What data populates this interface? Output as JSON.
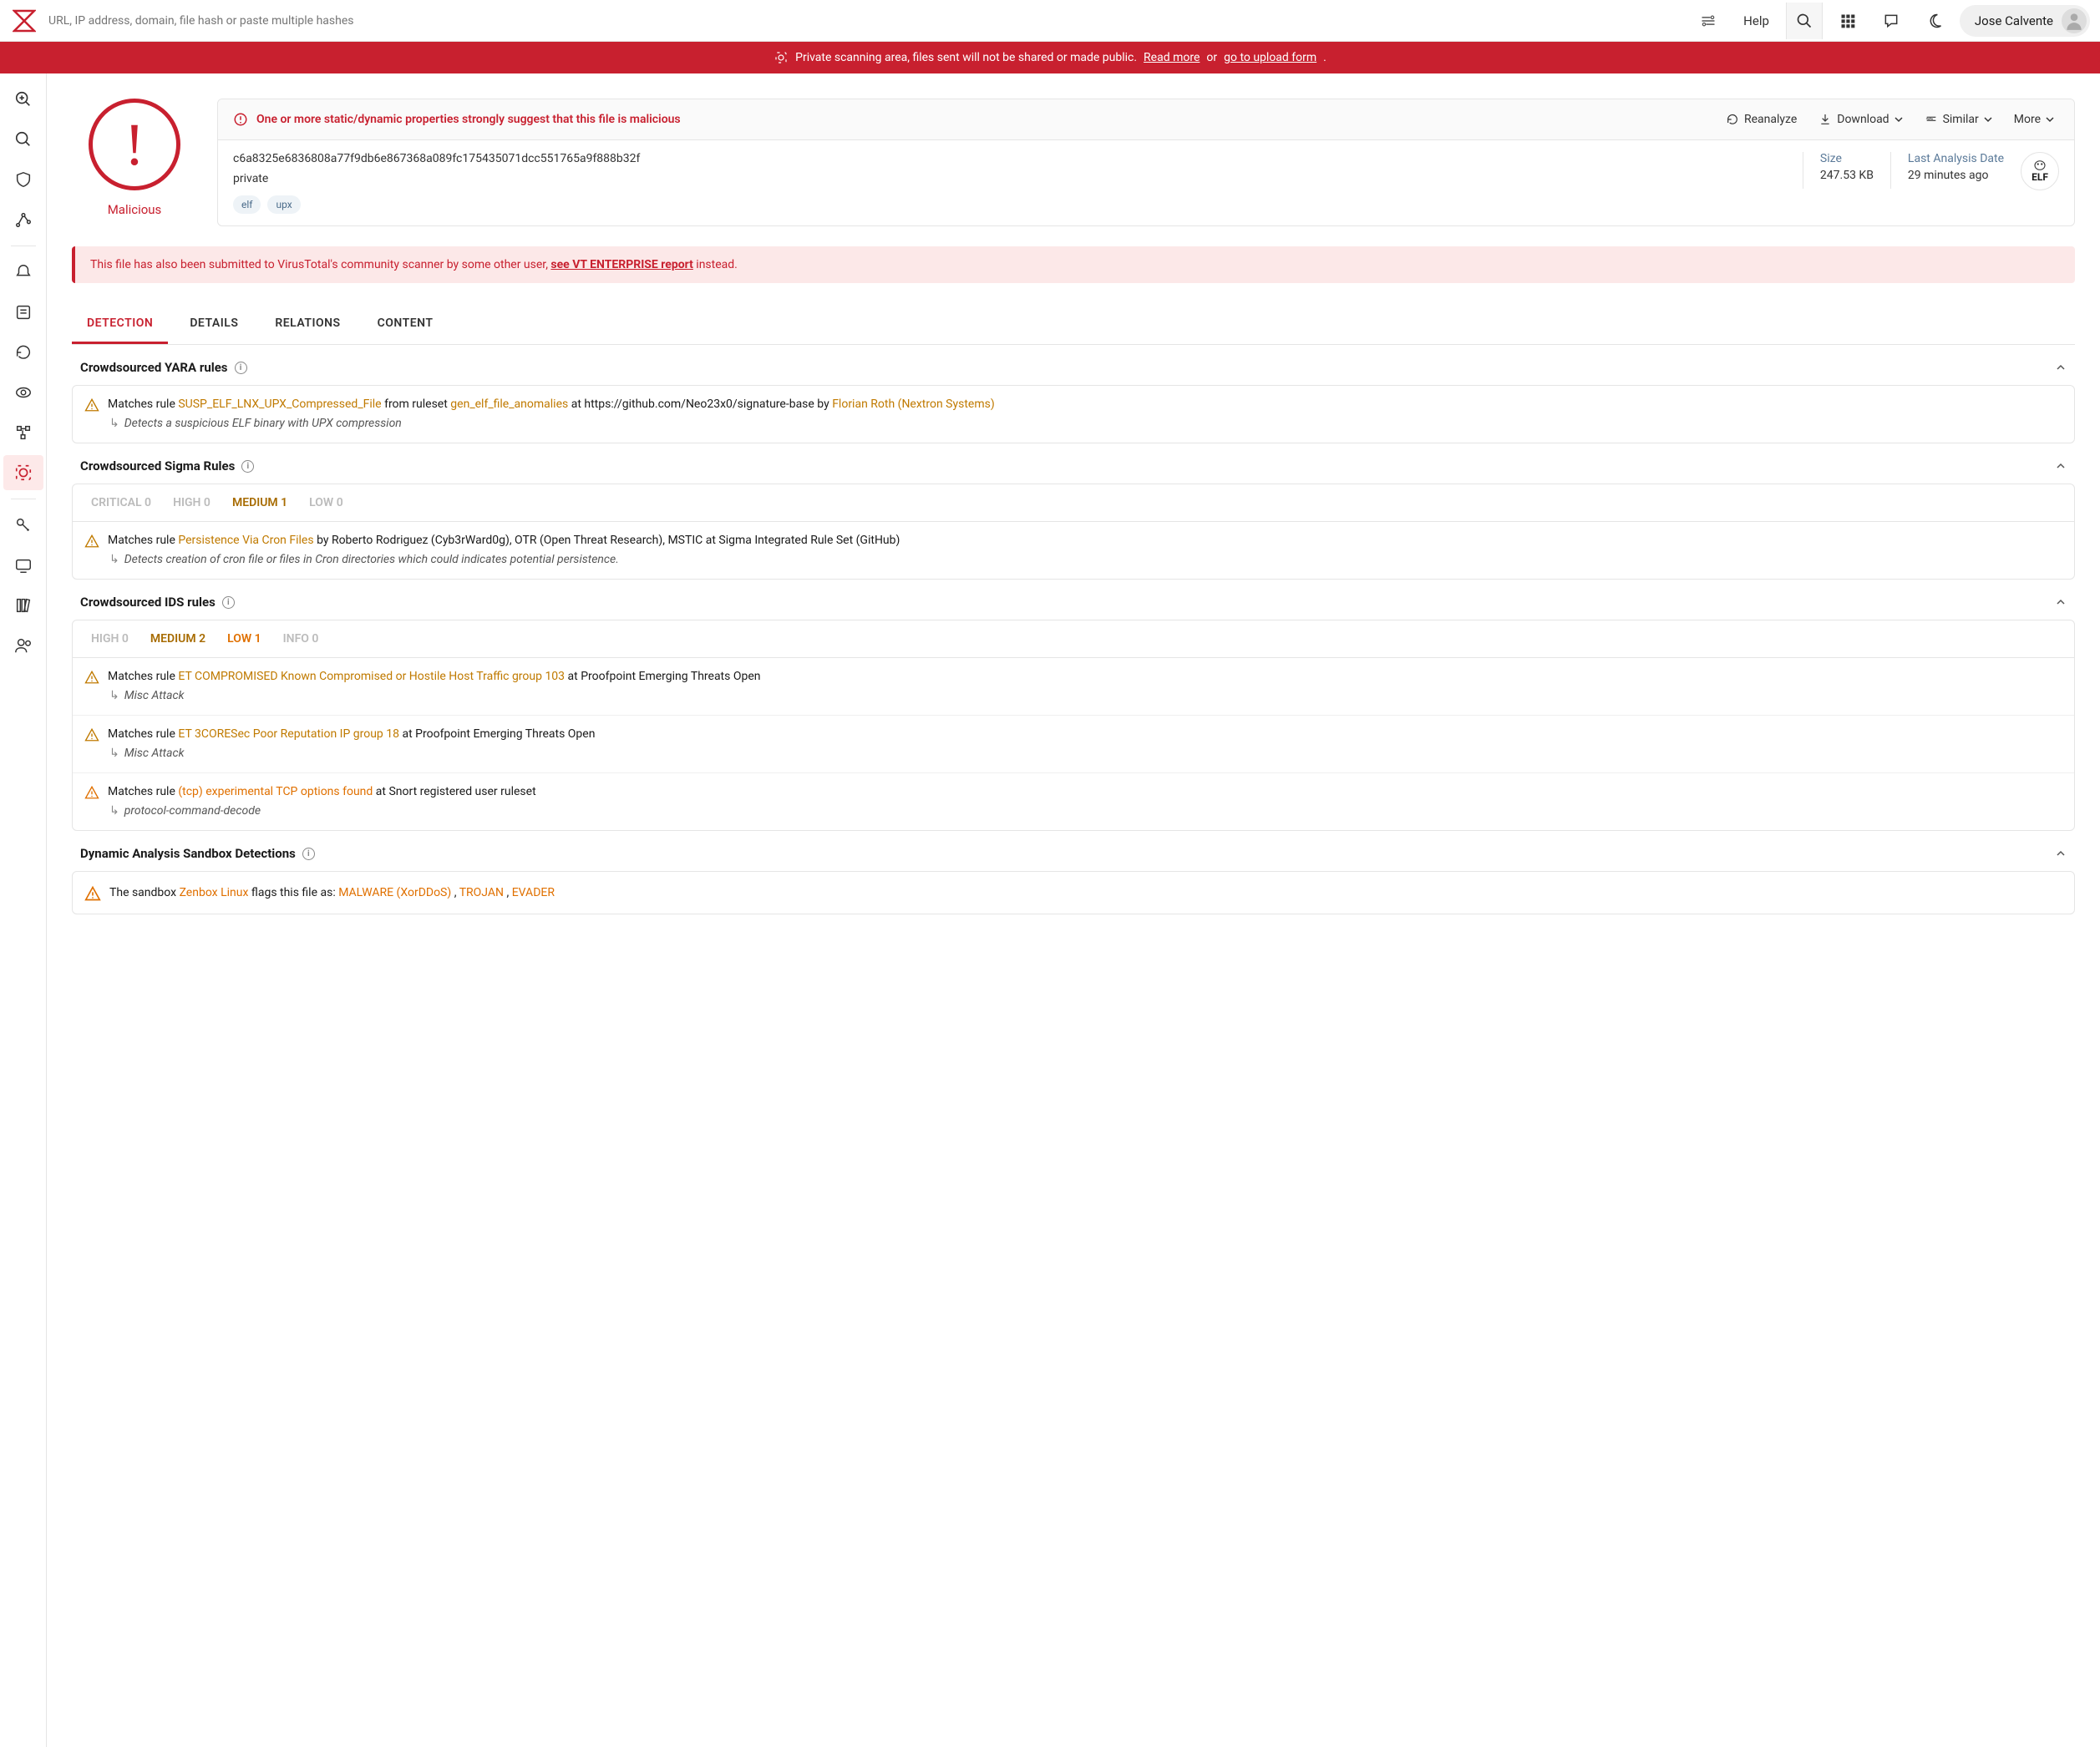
{
  "search": {
    "placeholder": "URL, IP address, domain, file hash or paste multiple hashes"
  },
  "topbar": {
    "help": "Help",
    "user": "Jose Calvente"
  },
  "banner": {
    "prefix": "Private scanning area, files sent will not be shared or made public.",
    "readmore": "Read more",
    "or": "or",
    "upload": "go to upload form"
  },
  "verdict": {
    "label": "Malicious"
  },
  "alert": {
    "msg": "One or more static/dynamic properties strongly suggest that this file is malicious"
  },
  "actions": {
    "reanalyze": "Reanalyze",
    "download": "Download",
    "similar": "Similar",
    "more": "More"
  },
  "meta": {
    "hash": "c6a8325e6836808a77f9db6e867368a089fc175435071dcc551765a9f888b32f",
    "private": "private",
    "tags": [
      "elf",
      "upx"
    ],
    "size_label": "Size",
    "size": "247.53 KB",
    "date_label": "Last Analysis Date",
    "date": "29 minutes ago",
    "ftype": "ELF"
  },
  "notice": {
    "prefix": "This file has also been submitted to VirusTotal's community scanner by some other user, ",
    "link": "see VT ENTERPRISE report",
    "suffix": " instead."
  },
  "tabs": [
    "DETECTION",
    "DETAILS",
    "RELATIONS",
    "CONTENT"
  ],
  "yara": {
    "title": "Crowdsourced YARA rules",
    "rule": {
      "p1": "Matches rule ",
      "name": "SUSP_ELF_LNX_UPX_Compressed_File",
      "p2": " from ruleset ",
      "ruleset": "gen_elf_file_anomalies",
      "p3": " at https://github.com/Neo23x0/signature-base by ",
      "author": "Florian Roth (Nextron Systems)",
      "desc": "Detects a suspicious ELF binary with UPX compression"
    }
  },
  "sigma": {
    "title": "Crowdsourced Sigma Rules",
    "sev": [
      {
        "label": "CRITICAL 0",
        "cls": ""
      },
      {
        "label": "HIGH 0",
        "cls": ""
      },
      {
        "label": "MEDIUM 1",
        "cls": "active-brown"
      },
      {
        "label": "LOW 0",
        "cls": ""
      }
    ],
    "rule": {
      "p1": "Matches rule ",
      "name": "Persistence Via Cron Files",
      "p2": " by Roberto Rodriguez (Cyb3rWard0g), OTR (Open Threat Research), MSTIC at Sigma Integrated Rule Set (GitHub)",
      "desc": "Detects creation of cron file or files in Cron directories which could indicates potential persistence."
    }
  },
  "ids": {
    "title": "Crowdsourced IDS rules",
    "sev": [
      {
        "label": "HIGH 0",
        "cls": ""
      },
      {
        "label": "MEDIUM 2",
        "cls": "active-brown"
      },
      {
        "label": "LOW 1",
        "cls": "active-orange"
      },
      {
        "label": "INFO 0",
        "cls": ""
      }
    ],
    "rules": [
      {
        "p1": "Matches rule ",
        "name": "ET COMPROMISED Known Compromised or Hostile Host Traffic group 103",
        "p2": " at Proofpoint Emerging Threats Open",
        "desc": "Misc Attack",
        "color": "lnk"
      },
      {
        "p1": "Matches rule ",
        "name": "ET 3CORESec Poor Reputation IP group 18",
        "p2": " at Proofpoint Emerging Threats Open",
        "desc": "Misc Attack",
        "color": "lnk"
      },
      {
        "p1": "Matches rule ",
        "name": "(tcp) experimental TCP options found",
        "p2": " at Snort registered user ruleset",
        "desc": "protocol-command-decode",
        "color": "lnk-o"
      }
    ]
  },
  "sandbox": {
    "title": "Dynamic Analysis Sandbox Detections",
    "p1": "The sandbox ",
    "name": "Zenbox Linux",
    "p2": " flags this file as: ",
    "flags": [
      "MALWARE (XorDDoS)",
      "TROJAN",
      "EVADER"
    ]
  }
}
